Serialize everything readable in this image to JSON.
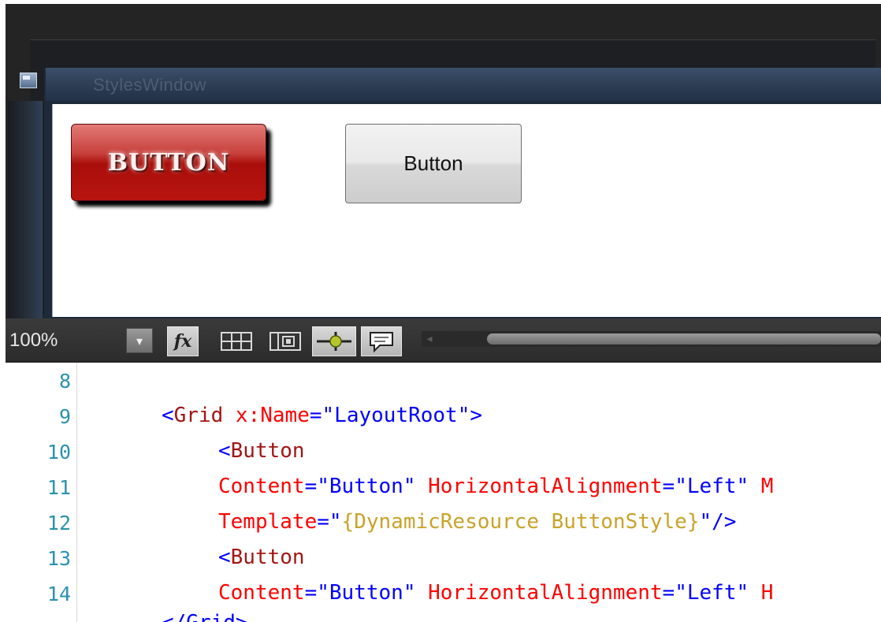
{
  "designer": {
    "window_title": "StylesWindow",
    "styled_button_label": "BUTTON",
    "default_button_label": "Button"
  },
  "toolbar": {
    "zoom_level": "100%",
    "zoom_dropdown_glyph": "▾",
    "tools": [
      {
        "name": "fx-icon",
        "glyph": "fx",
        "pressed": true
      },
      {
        "name": "grid-icon",
        "pressed": false
      },
      {
        "name": "snap-gridlines-icon",
        "pressed": false
      },
      {
        "name": "snap-points-icon",
        "pressed": true
      },
      {
        "name": "annotation-icon",
        "pressed": true
      }
    ],
    "scroll_left_glyph": "◂"
  },
  "editor": {
    "lines": [
      {
        "num": "8"
      },
      {
        "num": "9"
      },
      {
        "num": "10"
      },
      {
        "num": "11"
      },
      {
        "num": "12"
      },
      {
        "num": "13"
      },
      {
        "num": "14"
      }
    ],
    "code": {
      "l9_open": "<",
      "l9_tag": "Grid",
      "l9_attr": " x:Name",
      "l9_eq": "=\"",
      "l9_val": "LayoutRoot",
      "l9_close": "\">",
      "l10_open": "<",
      "l10_tag": "Button",
      "l11_attr1": "Content",
      "l11_eq1": "=\"",
      "l11_val1": "Button",
      "l11_q1": "\"",
      "l11_attr2": " HorizontalAlignment",
      "l11_eq2": "=\"",
      "l11_val2": "Left",
      "l11_q2": "\"",
      "l11_attr3": " M",
      "l12_attr": "Template",
      "l12_eq": "=\"",
      "l12_ext": "{DynamicResource ButtonStyle}",
      "l12_close": "\"/>",
      "l13_open": "<",
      "l13_tag": "Button",
      "l14_attr1": "Content",
      "l14_eq1": "=\"",
      "l14_val1": "Button",
      "l14_q1": "\"",
      "l14_attr2": " HorizontalAlignment",
      "l14_eq2": "=\"",
      "l14_val2": "Left",
      "l14_q2": "\"",
      "l14_attr3": " H",
      "l15_partial": "</Grid>"
    }
  },
  "colors": {
    "keyword_blue": "#0000ff",
    "attribute_red": "#ff0000",
    "markup_extension": "#c9a32a",
    "line_number": "#2b91af"
  }
}
